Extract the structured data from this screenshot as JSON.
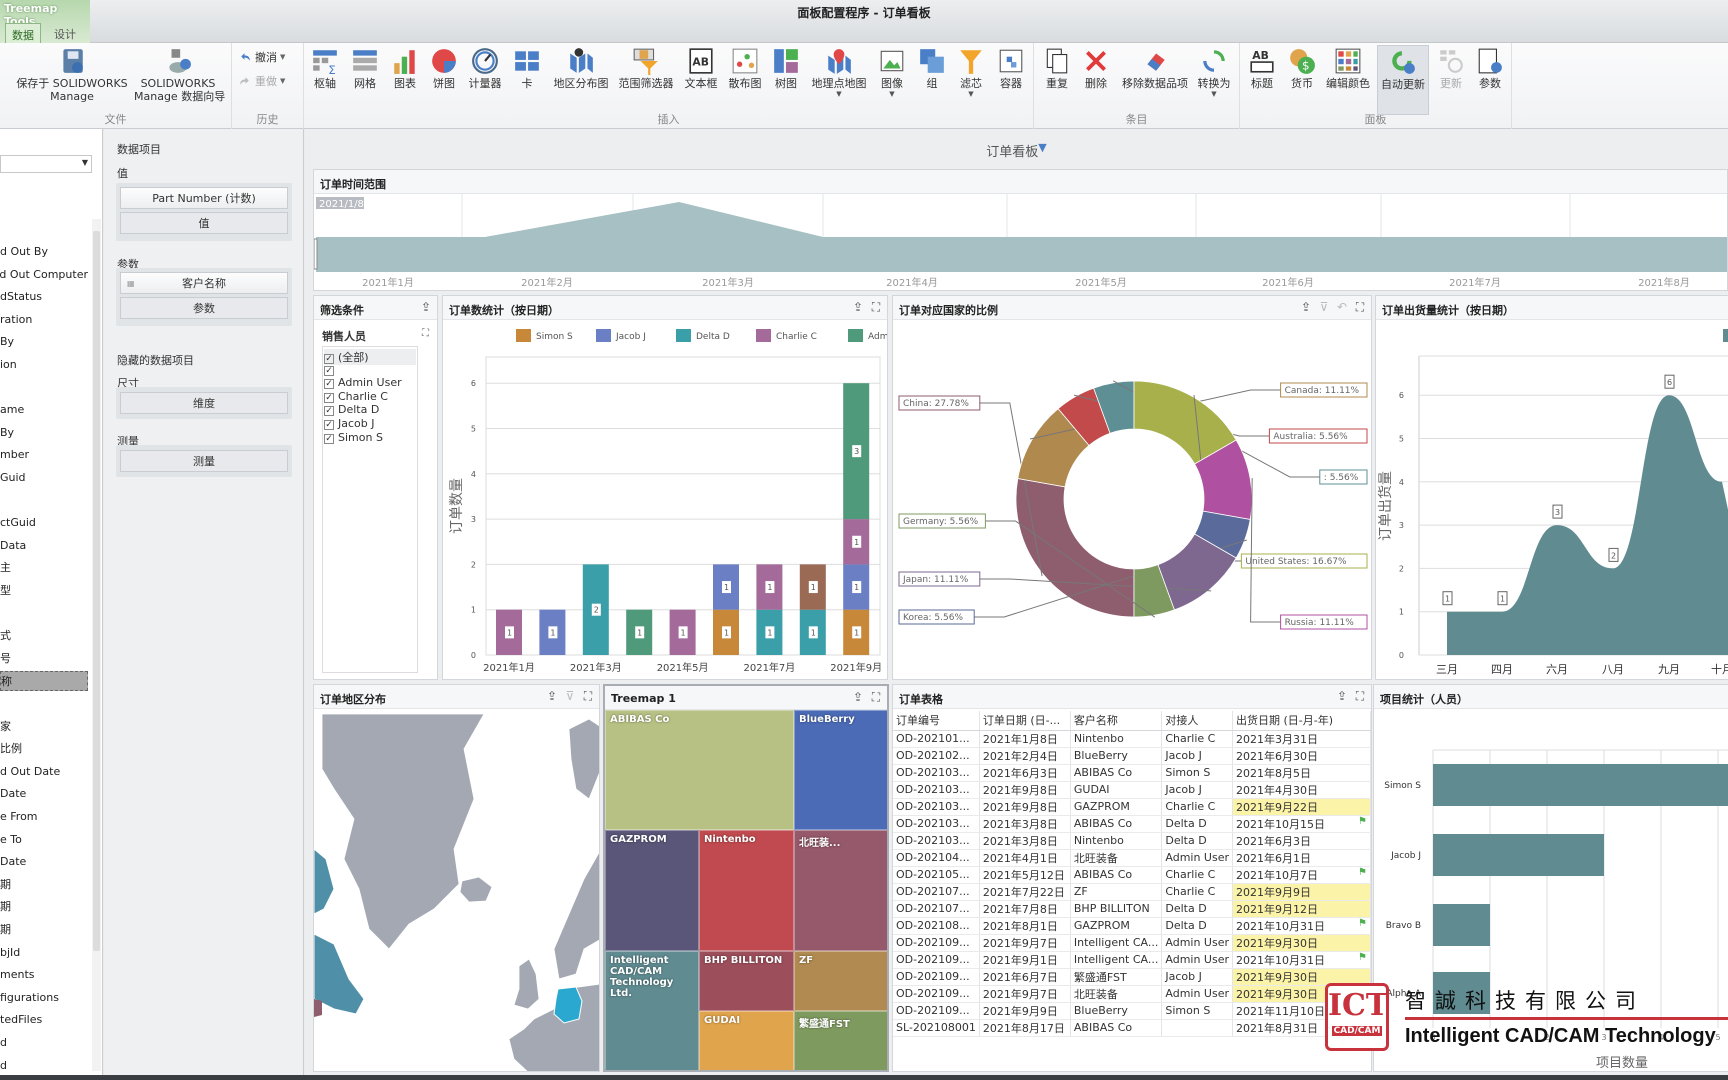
{
  "window": {
    "title": "面板配置程序 - 订单看板",
    "context_tab": "Treemap Tools",
    "tabs": [
      {
        "label": "数据",
        "selected": true
      },
      {
        "label": "设计",
        "selected": false
      }
    ]
  },
  "ribbon": {
    "groups": [
      {
        "label": "文件",
        "buttons": [
          {
            "label": "保存于 SOLIDWORKS",
            "label2": "Manage",
            "icon": "save-db-icon"
          },
          {
            "label": "SOLIDWORKS",
            "label2": "Manage 数据向导",
            "icon": "data-wizard-icon"
          }
        ]
      },
      {
        "label": "历史",
        "buttons": [
          {
            "label": "撤消",
            "icon": "undo-icon"
          },
          {
            "label": "重做",
            "icon": "redo-icon",
            "disabled": true
          }
        ]
      },
      {
        "label": "插入",
        "buttons": [
          {
            "label": "枢轴",
            "icon": "pivot-icon"
          },
          {
            "label": "网格",
            "icon": "grid-icon"
          },
          {
            "label": "图表",
            "icon": "chart-icon"
          },
          {
            "label": "饼图",
            "icon": "pie-icon"
          },
          {
            "label": "计量器",
            "icon": "gauge-icon"
          },
          {
            "label": "卡",
            "icon": "card-icon"
          },
          {
            "label": "地区分布图",
            "icon": "choropleth-icon"
          },
          {
            "label": "范围筛选器",
            "icon": "range-filter-icon"
          },
          {
            "label": "文本框",
            "icon": "textbox-icon"
          },
          {
            "label": "散布图",
            "icon": "scatter-icon"
          },
          {
            "label": "树图",
            "icon": "treemap-icon"
          },
          {
            "label": "地理点地图",
            "icon": "geo-point-icon",
            "dropdown": true
          },
          {
            "label": "图像",
            "icon": "image-icon",
            "dropdown": true
          },
          {
            "label": "组",
            "icon": "group-icon"
          },
          {
            "label": "滤芯",
            "icon": "filter-icon",
            "dropdown": true
          },
          {
            "label": "容器",
            "icon": "container-icon"
          }
        ]
      },
      {
        "label": "条目",
        "buttons": [
          {
            "label": "重复",
            "icon": "duplicate-icon"
          },
          {
            "label": "删除",
            "icon": "delete-icon"
          },
          {
            "label": "移除数据品项",
            "icon": "eraser-icon"
          },
          {
            "label": "转换为",
            "icon": "convert-icon",
            "dropdown": true
          }
        ]
      },
      {
        "label": "面板",
        "buttons": [
          {
            "label": "标题",
            "icon": "title-icon"
          },
          {
            "label": "货币",
            "icon": "currency-icon"
          },
          {
            "label": "编辑颜色",
            "icon": "edit-colors-icon"
          },
          {
            "label": "自动更新",
            "icon": "auto-update-icon",
            "active": true
          },
          {
            "label": "更新",
            "icon": "update-icon",
            "disabled": true
          },
          {
            "label": "参数",
            "icon": "parameters-icon"
          }
        ]
      }
    ]
  },
  "field_list": {
    "dropdown_value": "",
    "items": [
      "d Out By",
      "d Out Computer",
      "dStatus",
      "ration",
      " By",
      "ion",
      "",
      "ame",
      " By",
      "mber",
      "Guid",
      "",
      "ctGuid",
      "Data",
      "主",
      "型",
      "",
      "式",
      "号",
      "称",
      "",
      "家",
      "比例",
      "d Out Date",
      " Date",
      "e From",
      "e To",
      " Date",
      "期",
      "期",
      "期",
      "bjId",
      "ments",
      "figurations",
      "tedFiles",
      "d",
      "d"
    ],
    "selected_index": 19
  },
  "data_items": {
    "title": "数据项目",
    "values_label": "值",
    "values_item": "Part Number (计数)",
    "values_placeholder": "值",
    "params_label": "参数",
    "params_item": "客户名称",
    "params_placeholder": "参数",
    "hidden_title": "隐藏的数据项目",
    "dims_label": "尺寸",
    "dims_placeholder": "维度",
    "measures_label": "测量",
    "measures_placeholder": "测量"
  },
  "dashboard": {
    "title": "订单看板",
    "title_icon": "filter-icon",
    "accent": "#4a7fc8"
  },
  "range_panel": {
    "title": "订单时间范围",
    "selection_label": "2021/1/8",
    "ticks": [
      "2021年1月",
      "2021年2月",
      "2021年3月",
      "2021年4月",
      "2021年5月",
      "2021年6月",
      "2021年7月",
      "2021年8月"
    ],
    "fill": "#a7c0c4"
  },
  "filter_panel": {
    "title": "筛选条件",
    "group": "销售人员",
    "items": [
      {
        "label": "(全部)",
        "checked": true
      },
      {
        "label": "",
        "checked": true
      },
      {
        "label": "Admin User",
        "checked": true
      },
      {
        "label": "Charlie C",
        "checked": true
      },
      {
        "label": "Delta D",
        "checked": true
      },
      {
        "label": "Jacob J",
        "checked": true
      },
      {
        "label": "Simon S",
        "checked": true
      }
    ]
  },
  "bar_panel": {
    "title": "订单数统计（按日期）"
  },
  "donut_panel": {
    "title": "订单对应国家的比例"
  },
  "area_panel": {
    "title": "订单出货量统计（按日期）"
  },
  "map_panel": {
    "title": "订单地区分布",
    "highlight": "#2aa8d0"
  },
  "treemap_panel": {
    "title": "Treemap 1",
    "tiles": [
      {
        "label": "ABIBAS Co",
        "color": "#b8c184"
      },
      {
        "label": "BlueBerry",
        "color": "#4b6bb7"
      },
      {
        "label": "GAZPROM",
        "color": "#5a5679"
      },
      {
        "label": "Nintenbo",
        "color": "#c04a4f"
      },
      {
        "label": "北旺装...",
        "color": "#96586b"
      },
      {
        "label": "Intelligent CAD/CAM Technology Ltd.",
        "color": "#5f8b91"
      },
      {
        "label": "BHP BILLITON",
        "color": "#9d4e5b"
      },
      {
        "label": "ZF",
        "color": "#b08a50"
      },
      {
        "label": "GUDAI",
        "color": "#e0a44c"
      },
      {
        "label": "繁盛通FST",
        "color": "#7f9a5f"
      }
    ]
  },
  "table_panel": {
    "title": "订单表格",
    "columns": [
      "订单编号",
      "订单日期 (日-...",
      "客户名称",
      "对接人",
      "出货日期 (日-月-年)"
    ],
    "rows": [
      {
        "cells": [
          "OD-202101...",
          "2021年1月8日",
          "Nintenbo",
          "Charlie C",
          "2021年3月31日"
        ]
      },
      {
        "cells": [
          "OD-202102...",
          "2021年2月4日",
          "BlueBerry",
          "Jacob J",
          "2021年6月30日"
        ]
      },
      {
        "cells": [
          "OD-202103...",
          "2021年6月3日",
          "ABIBAS Co",
          "Simon S",
          "2021年8月5日"
        ]
      },
      {
        "cells": [
          "OD-202103...",
          "2021年9月8日",
          "GUDAI",
          "Jacob J",
          "2021年4月30日"
        ]
      },
      {
        "cells": [
          "OD-202103...",
          "2021年9月8日",
          "GAZPROM",
          "Charlie C",
          "2021年9月22日"
        ],
        "highlight": true
      },
      {
        "cells": [
          "OD-202103...",
          "2021年3月8日",
          "ABIBAS Co",
          "Delta D",
          "2021年10月15日"
        ],
        "flag": true
      },
      {
        "cells": [
          "OD-202103...",
          "2021年3月8日",
          "Nintenbo",
          "Delta D",
          "2021年6月3日"
        ]
      },
      {
        "cells": [
          "OD-202104...",
          "2021年4月1日",
          "北旺装备",
          "Admin User",
          "2021年6月1日"
        ]
      },
      {
        "cells": [
          "OD-202105...",
          "2021年5月12日",
          "ABIBAS Co",
          "Charlie C",
          "2021年10月7日"
        ],
        "flag": true
      },
      {
        "cells": [
          "OD-202107...",
          "2021年7月22日",
          "ZF",
          "Charlie C",
          "2021年9月9日"
        ],
        "highlight": true
      },
      {
        "cells": [
          "OD-202107...",
          "2021年7月8日",
          "BHP BILLITON",
          "Delta D",
          "2021年9月12日"
        ],
        "highlight": true
      },
      {
        "cells": [
          "OD-202108...",
          "2021年8月1日",
          "GAZPROM",
          "Delta D",
          "2021年10月31日"
        ],
        "flag": true
      },
      {
        "cells": [
          "OD-202109...",
          "2021年9月7日",
          "Intelligent CA...",
          "Admin User",
          "2021年9月30日"
        ],
        "highlight": true
      },
      {
        "cells": [
          "OD-202109...",
          "2021年9月1日",
          "Intelligent CA...",
          "Admin User",
          "2021年10月31日"
        ],
        "flag": true
      },
      {
        "cells": [
          "OD-202109...",
          "2021年6月7日",
          "繁盛通FST",
          "Jacob J",
          "2021年9月30日"
        ],
        "highlight": true
      },
      {
        "cells": [
          "OD-202109...",
          "2021年9月7日",
          "北旺装备",
          "Admin User",
          "2021年9月30日"
        ],
        "highlight": true
      },
      {
        "cells": [
          "OD-202109...",
          "2021年9月9日",
          "BlueBerry",
          "Simon S",
          "2021年11月10日"
        ]
      },
      {
        "cells": [
          "SL-202108001",
          "2021年8月17日",
          "ABIBAS Co",
          "",
          "2021年8月31日"
        ]
      }
    ],
    "highlight_color": "#fbf3a8",
    "flag_color": "#4caf50"
  },
  "hbar_panel": {
    "title": "项目统计（人员）"
  },
  "logo": {
    "cn": "智誠科技有限公司",
    "en": "Intelligent CAD/CAM Technology",
    "mark": "ICT",
    "mark_sub": "CAD/CAM"
  },
  "chart_data": [
    {
      "type": "bar",
      "stacked": true,
      "title": "订单数统计（按日期）",
      "ylabel": "订单数量",
      "ylim": [
        0,
        6
      ],
      "categories": [
        "2021年1月",
        "2021年2月",
        "2021年3月",
        "2021年4月",
        "2021年5月",
        "2021年6月",
        "2021年7月",
        "2021年8月",
        "2021年9月"
      ],
      "tick_labels": [
        "2021年1月",
        "2021年3月",
        "2021年5月",
        "2021年7月",
        "2021年9月"
      ],
      "yticks": [
        "0",
        "1",
        "2",
        "3",
        "4",
        "5",
        "6"
      ],
      "legend": "top",
      "series": [
        {
          "name": "Simon S",
          "color": "#c8883a",
          "values": [
            0,
            0,
            0,
            0,
            0,
            1,
            0,
            0,
            1
          ]
        },
        {
          "name": "Delta D",
          "color": "#3a9fa8",
          "values": [
            0,
            0,
            2,
            0,
            0,
            0,
            1,
            1,
            0
          ]
        },
        {
          "name": "Jacob J",
          "color": "#6b7fc4",
          "values": [
            0,
            1,
            0,
            0,
            0,
            1,
            0,
            0,
            1
          ]
        },
        {
          "name": "Charlie C",
          "color": "#a46a9a",
          "values": [
            1,
            0,
            0,
            0,
            1,
            0,
            1,
            0,
            1
          ]
        },
        {
          "name": "",
          "color": "#9a6a55",
          "values": [
            0,
            0,
            0,
            0,
            0,
            0,
            0,
            1,
            0
          ]
        },
        {
          "name": "Admin User",
          "color": "#4f9a7a",
          "values": [
            0,
            0,
            0,
            1,
            0,
            0,
            0,
            0,
            3
          ]
        }
      ],
      "legend_order": [
        "Simon S",
        "Jacob J",
        "Delta D",
        "Charlie C",
        "Admin User",
        ""
      ]
    },
    {
      "type": "pie",
      "donut": true,
      "title": "订单对应国家的比例",
      "slices": [
        {
          "label": "China",
          "value": 27.78,
          "color": "#8f5e6e"
        },
        {
          "label": "Canada",
          "value": 11.11,
          "color": "#b0894e"
        },
        {
          "label": "Australia",
          "value": 5.56,
          "color": "#c24a4a"
        },
        {
          "label": "",
          "value": 5.56,
          "color": "#5e8f94"
        },
        {
          "label": "United States",
          "value": 16.67,
          "color": "#a8b04c"
        },
        {
          "label": "Russia",
          "value": 11.11,
          "color": "#b050a0"
        },
        {
          "label": "Korea",
          "value": 5.56,
          "color": "#5a6a9a"
        },
        {
          "label": "Japan",
          "value": 11.11,
          "color": "#7e6890"
        },
        {
          "label": "Germany",
          "value": 5.56,
          "color": "#7f9a60"
        }
      ]
    },
    {
      "type": "area",
      "title": "订单出货量统计（按日期）",
      "ylabel": "订单出货量",
      "ylim": [
        0,
        6
      ],
      "categories": [
        "三月",
        "四月",
        "六月",
        "八月",
        "九月",
        "十月"
      ],
      "values": [
        1,
        1,
        3,
        2,
        6,
        4
      ],
      "point_labels": [
        "1",
        "1",
        "3",
        "2",
        "6",
        ""
      ],
      "yticks": [
        "0",
        "1",
        "2",
        "3",
        "4",
        "5",
        "6"
      ],
      "color": "#5f8b91"
    },
    {
      "type": "bar",
      "orientation": "horizontal",
      "title": "项目统计（人员）",
      "xlabel": "项目数量",
      "categories": [
        "Simon S",
        "Jacob J",
        "Bravo B",
        "Alpha A"
      ],
      "values": [
        6,
        3,
        1,
        1
      ],
      "xticks": [
        "0",
        "1",
        "2",
        "3",
        "4",
        "5"
      ],
      "color": "#5f8b91"
    }
  ]
}
